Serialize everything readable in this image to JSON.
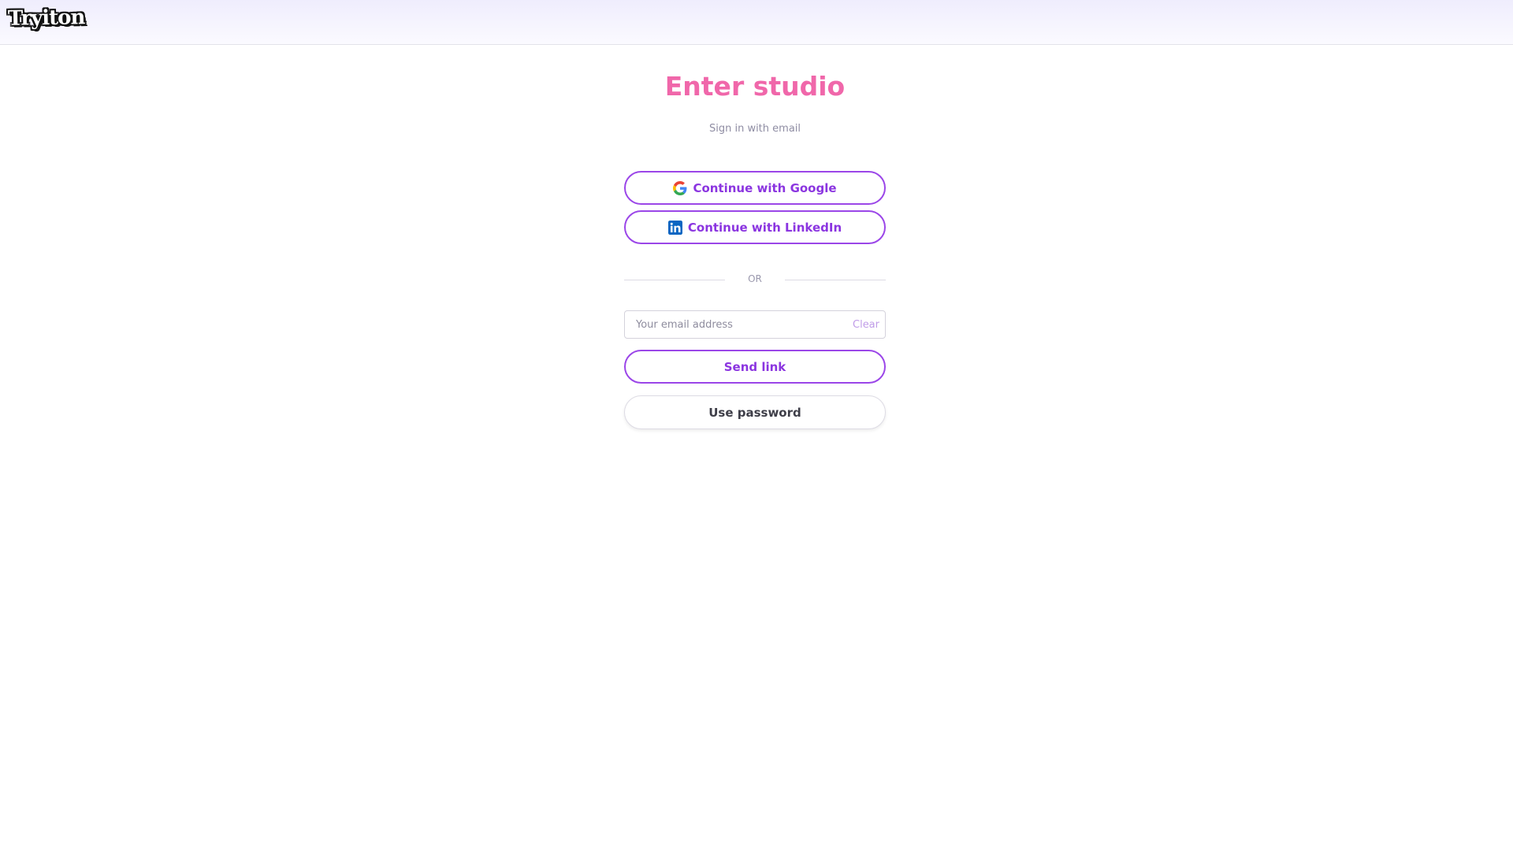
{
  "header": {
    "logo_text": "Tryiton"
  },
  "login": {
    "title": "Enter studio",
    "subtitle": "Sign in with email",
    "google_button": "Continue with Google",
    "linkedin_button": "Continue with LinkedIn",
    "divider": "OR",
    "email_placeholder": "Your email address",
    "email_value": "",
    "clear_label": "Clear",
    "send_link_button": "Send link",
    "use_password_button": "Use password"
  },
  "colors": {
    "title_pink": "#f067aa",
    "accent_purple": "#8b35e0",
    "linkedin_blue": "#0a66c2"
  },
  "icons": {
    "google": "google-icon",
    "linkedin": "linkedin-icon"
  }
}
